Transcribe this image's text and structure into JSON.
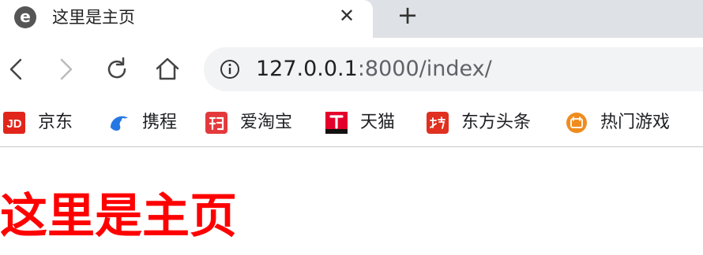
{
  "tab": {
    "favicon": "browser-logo-icon",
    "title": "这里是主页",
    "close": "✕",
    "new_tab": "+"
  },
  "nav": {
    "back": "back-arrow-icon",
    "forward": "forward-arrow-icon",
    "reload": "reload-icon",
    "home": "home-icon"
  },
  "address": {
    "info_icon": "info-icon",
    "host": "127.0.0.1",
    "rest": ":8000/index/"
  },
  "bookmarks": [
    {
      "label": "京东",
      "icon": "jd-icon",
      "color": "#e1251b"
    },
    {
      "label": "携程",
      "icon": "ctrip-icon",
      "color": "#2577e3"
    },
    {
      "label": "爱淘宝",
      "icon": "taobao-icon",
      "color": "#e4393c"
    },
    {
      "label": "天猫",
      "icon": "tmall-icon",
      "color": "#e4002b"
    },
    {
      "label": "东方头条",
      "icon": "eastday-icon",
      "color": "#e03020"
    },
    {
      "label": "热门游戏",
      "icon": "game-icon",
      "color": "#f08c1e"
    }
  ],
  "page": {
    "heading": "这里是主页",
    "heading_color": "#ff0000"
  }
}
